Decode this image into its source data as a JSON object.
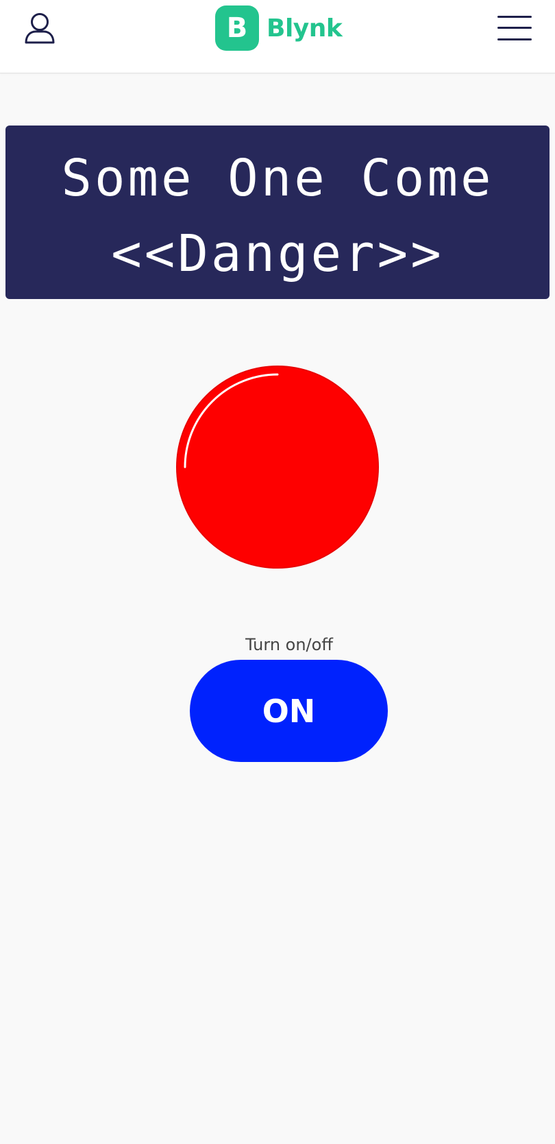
{
  "app": {
    "logo_letter": "B",
    "logo_text": "Blynk",
    "brand_color": "#23c48e",
    "header_icons": [
      "user-icon",
      "hamburger-menu-icon"
    ]
  },
  "lcd": {
    "line1": "Some One Come",
    "line2": "<<Danger>>",
    "background": "#27285a",
    "text_color": "#ffffff"
  },
  "led": {
    "color": "#fe0000",
    "state": "on"
  },
  "switch": {
    "label": "Turn on/off",
    "value": "ON",
    "color": "#0022fd"
  }
}
